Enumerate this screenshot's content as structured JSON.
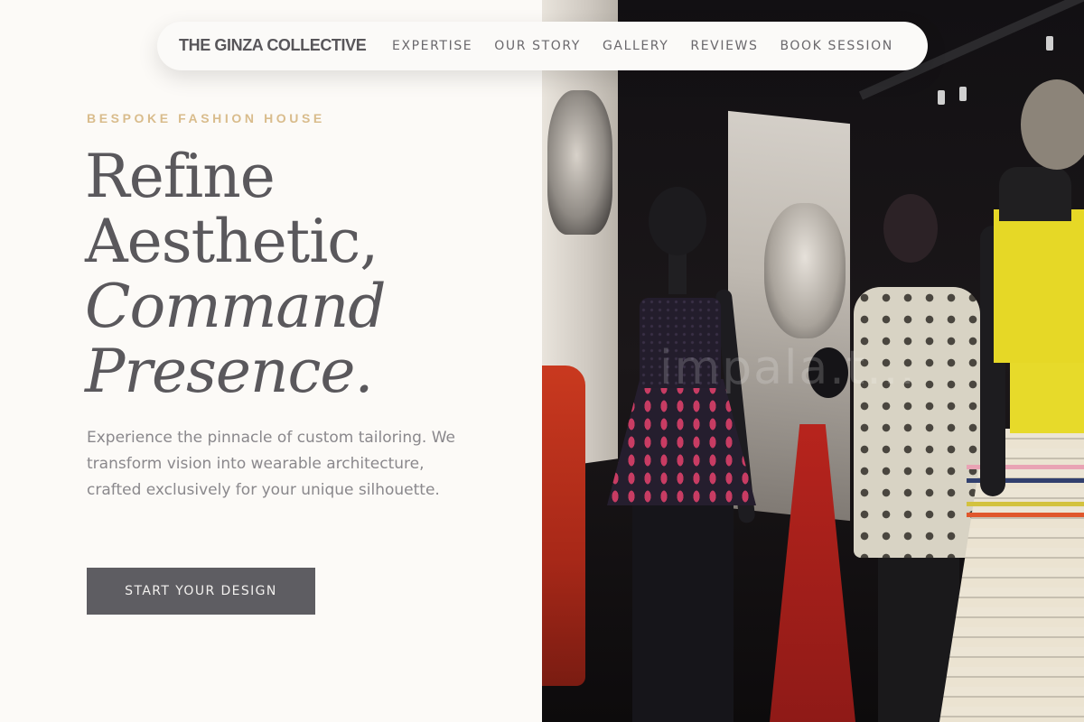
{
  "nav": {
    "brand": "THE GINZA COLLECTIVE",
    "links": [
      "EXPERTISE",
      "OUR STORY",
      "GALLERY",
      "REVIEWS",
      "BOOK SESSION"
    ]
  },
  "hero": {
    "eyebrow": "BESPOKE FASHION HOUSE",
    "headline": {
      "line1": "Refine",
      "line2": "Aesthetic,",
      "line3": "Command",
      "line4": "Presence."
    },
    "lede": "Experience the pinnacle of custom tailoring. We transform vision into wearable architecture, crafted exclusively for your unique silhouette.",
    "cta_label": "START YOUR DESIGN"
  },
  "photo": {
    "watermark": "impala.t..."
  },
  "colors": {
    "background": "#fcfaf7",
    "eyebrow_gold": "#d9bc8c",
    "text_dark": "#5a585c",
    "text_muted": "#8a888c",
    "button_bg": "#5e5d62",
    "button_text": "#f2f0ee"
  }
}
